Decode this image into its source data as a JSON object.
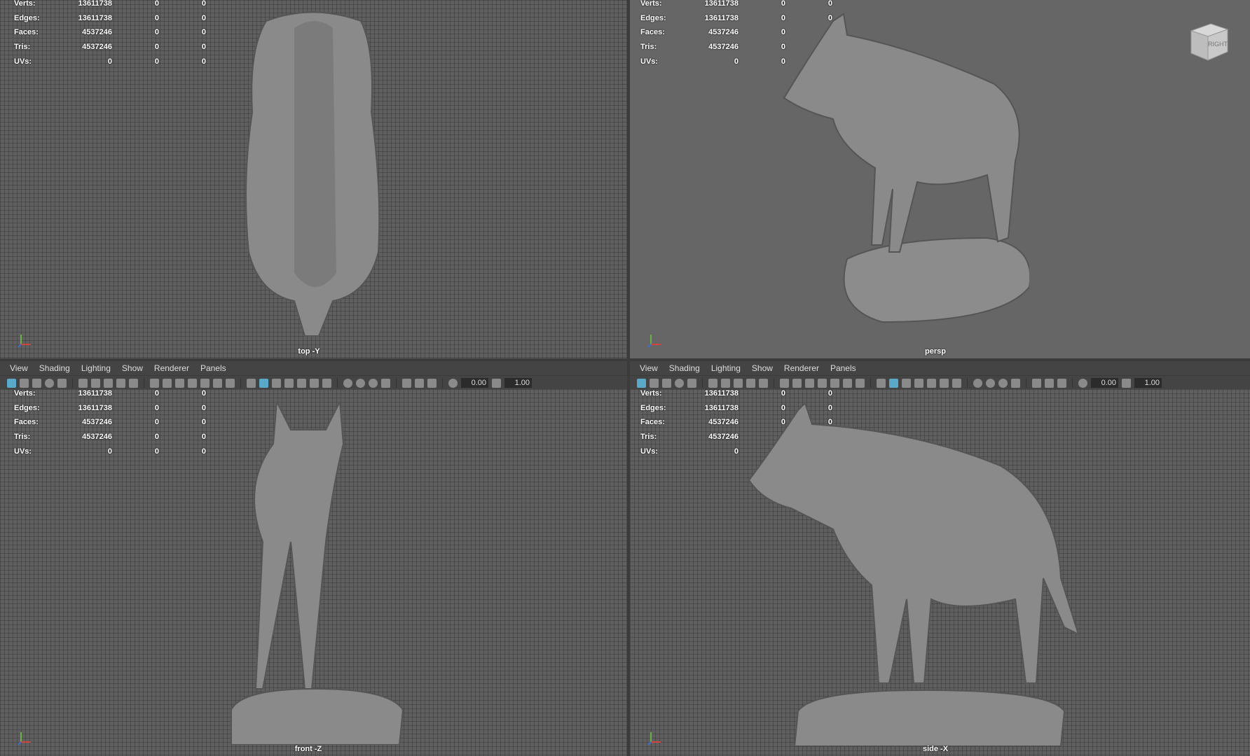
{
  "menu": [
    "View",
    "Shading",
    "Lighting",
    "Show",
    "Renderer",
    "Panels"
  ],
  "toolbar": {
    "field_a": "0.00",
    "field_b": "1.00"
  },
  "hud_labels": [
    "Verts:",
    "Edges:",
    "Faces:",
    "Tris:",
    "UVs:"
  ],
  "hud_values": [
    [
      "13611738",
      "0",
      "0"
    ],
    [
      "13611738",
      "0",
      "0"
    ],
    [
      "4537246",
      "0",
      "0"
    ],
    [
      "4537246",
      "0",
      "0"
    ],
    [
      "0",
      "0",
      "0"
    ]
  ],
  "viewports": [
    {
      "id": "top",
      "camera": "top -Y"
    },
    {
      "id": "persp",
      "camera": "persp"
    },
    {
      "id": "front",
      "camera": "front -Z"
    },
    {
      "id": "side",
      "camera": "side -X"
    }
  ],
  "viewcube_label": "RIGHT",
  "colors": {
    "accent": "#5aa9c8",
    "panel": "#444444",
    "viewport": "#616161",
    "model": "#8c8c8c"
  }
}
